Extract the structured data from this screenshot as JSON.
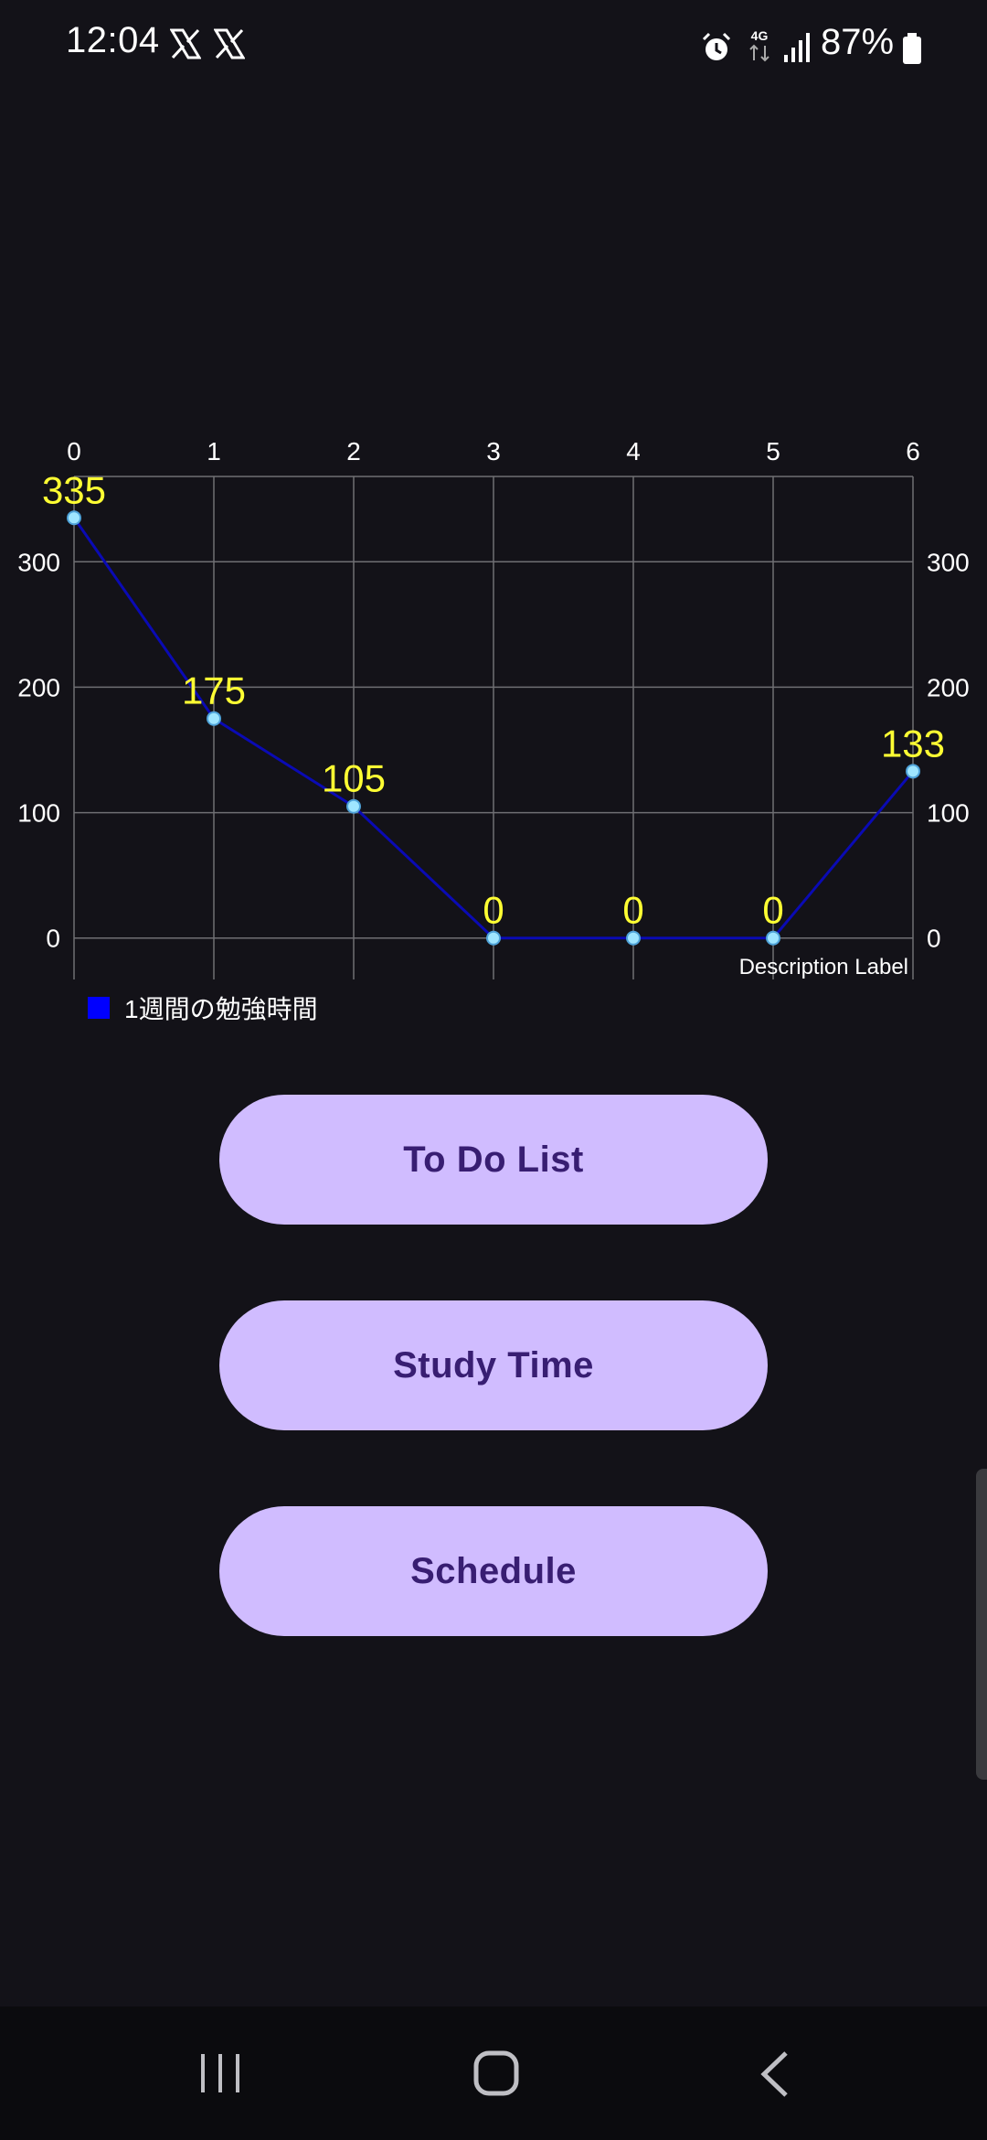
{
  "status_bar": {
    "time": "12:04",
    "network": "4G",
    "battery": "87%",
    "icons": [
      "x-icon",
      "x-icon",
      "alarm-icon",
      "4g-icon",
      "signal-icon",
      "battery-icon"
    ]
  },
  "chart_data": {
    "type": "line",
    "x": [
      0,
      1,
      2,
      3,
      4,
      5,
      6
    ],
    "values": [
      335,
      175,
      105,
      0,
      0,
      0,
      133
    ],
    "series": [
      {
        "name": "1週間の勉強時間",
        "values": [
          335,
          175,
          105,
          0,
          0,
          0,
          133
        ]
      }
    ],
    "x_tick_labels": [
      "0",
      "1",
      "2",
      "3",
      "4",
      "5",
      "6"
    ],
    "y_tick_labels": [
      "0",
      "100",
      "200",
      "300"
    ],
    "y_ticks": [
      0,
      100,
      200,
      300
    ],
    "ylim": [
      -33,
      368
    ],
    "xlim": [
      0,
      6
    ],
    "description": "Description Label",
    "grid": true,
    "legend_position": "bottom-left",
    "line_color": "#0a0ab4",
    "point_color": "#9fe6ff",
    "value_label_color": "#ffff33",
    "grid_color": "#6f6f73"
  },
  "buttons": {
    "todo": "To Do List",
    "study": "Study Time",
    "schedule": "Schedule"
  },
  "colors": {
    "background": "#131218",
    "button_bg": "#d0bcff",
    "button_text": "#381e72",
    "legend_swatch": "#0000ff"
  },
  "nav": {
    "icons": [
      "recent-apps-icon",
      "home-icon",
      "back-icon"
    ]
  }
}
